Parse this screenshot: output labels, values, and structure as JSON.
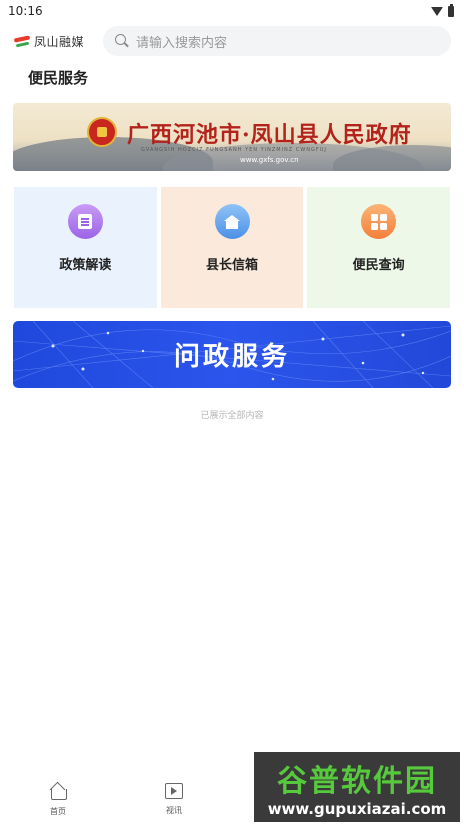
{
  "status_bar": {
    "time": "10:16"
  },
  "header": {
    "logo_text": "凤山融媒",
    "search_placeholder": "请输入搜索内容"
  },
  "section": {
    "title": "便民服务"
  },
  "banner": {
    "title": "广西河池市·凤山县人民政府",
    "subtitle": "GVANGSIH HOZCIZ FUNGSANH YEN YINZMINZ CWNGFUJ",
    "url": "www.gxfs.gov.cn"
  },
  "cards": [
    {
      "label": "政策解读",
      "icon": "document-icon"
    },
    {
      "label": "县长信箱",
      "icon": "mailbox-icon"
    },
    {
      "label": "便民查询",
      "icon": "grid-icon"
    }
  ],
  "service_banner": {
    "title": "问政服务"
  },
  "end_text": "已展示全部内容",
  "bottom_nav": [
    {
      "label": "首页",
      "icon": "home-icon"
    },
    {
      "label": "视讯",
      "icon": "video-icon"
    }
  ],
  "watermark": {
    "title": "谷普软件园",
    "url": "www.gupuxiazai.com"
  },
  "colors": {
    "accent_blue": "#2b55ec",
    "watermark_green": "#57c93d",
    "banner_red": "#b3231c"
  }
}
